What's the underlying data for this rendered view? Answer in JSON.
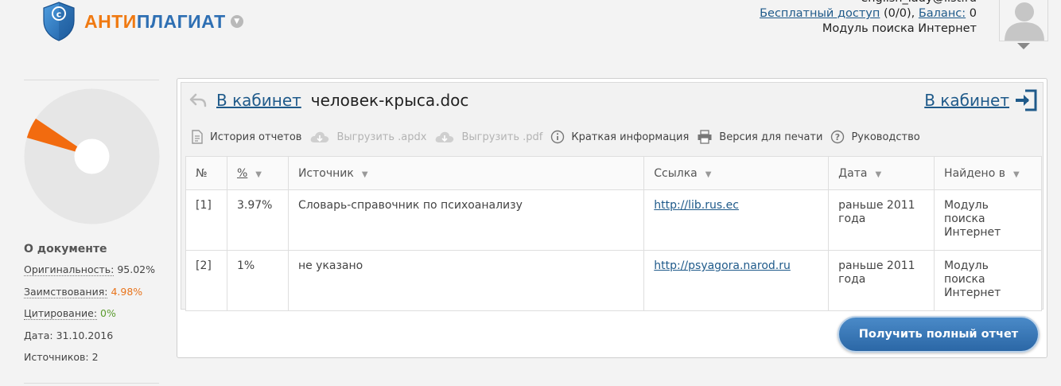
{
  "header": {
    "logo_part1": "АНТИ",
    "logo_part2": "ПЛАГИАТ",
    "email": "english_lady@list.ru",
    "free_access_label": "Бесплатный доступ",
    "free_access_count": " (0/0), ",
    "balance_label": "Баланс:",
    "balance_value": " 0",
    "module": "Модуль поиска Интернет"
  },
  "sidebar": {
    "title": "О документе",
    "originality_label": "Оригинальность:",
    "originality_value": "95.02%",
    "borrowing_label": "Заимствования:",
    "borrowing_value": "4.98%",
    "citation_label": "Цитирование:",
    "citation_value": "0%",
    "date_label": "Дата:",
    "date_value": "31.10.2016",
    "sources_label": "Источников:",
    "sources_value": "2"
  },
  "pie": {
    "borrowing_fraction": 0.0498,
    "colors": {
      "original": "#e6e6e6",
      "borrowing": "#f26b0f",
      "citation": "#6aa84f"
    }
  },
  "panel": {
    "back_link": "В кабинет",
    "doc_name": "человек-крыса.doc",
    "right_link": "В кабинет"
  },
  "toolbar": {
    "history": "История отчетов",
    "export_apdx": "Выгрузить .apdx",
    "export_pdf": "Выгрузить .pdf",
    "brief_info": "Краткая информация",
    "print_version": "Версия для печати",
    "guide": "Руководство"
  },
  "table": {
    "headers": {
      "num": "№",
      "pct": "%",
      "source": "Источник",
      "link": "Ссылка",
      "date": "Дата",
      "found_in": "Найдено в"
    },
    "rows": [
      {
        "num": "[1]",
        "pct": "3.97%",
        "source": "Словарь-справочник по психоанализу",
        "link": "http://lib.rus.ec",
        "date": "раньше 2011 года",
        "found_in": "Модуль поиска Интернет"
      },
      {
        "num": "[2]",
        "pct": "1%",
        "source": "не указано",
        "link": "http://psyagora.narod.ru",
        "date": "раньше 2011 года",
        "found_in": "Модуль поиска Интернет"
      }
    ]
  },
  "full_report_button": "Получить полный отчет"
}
